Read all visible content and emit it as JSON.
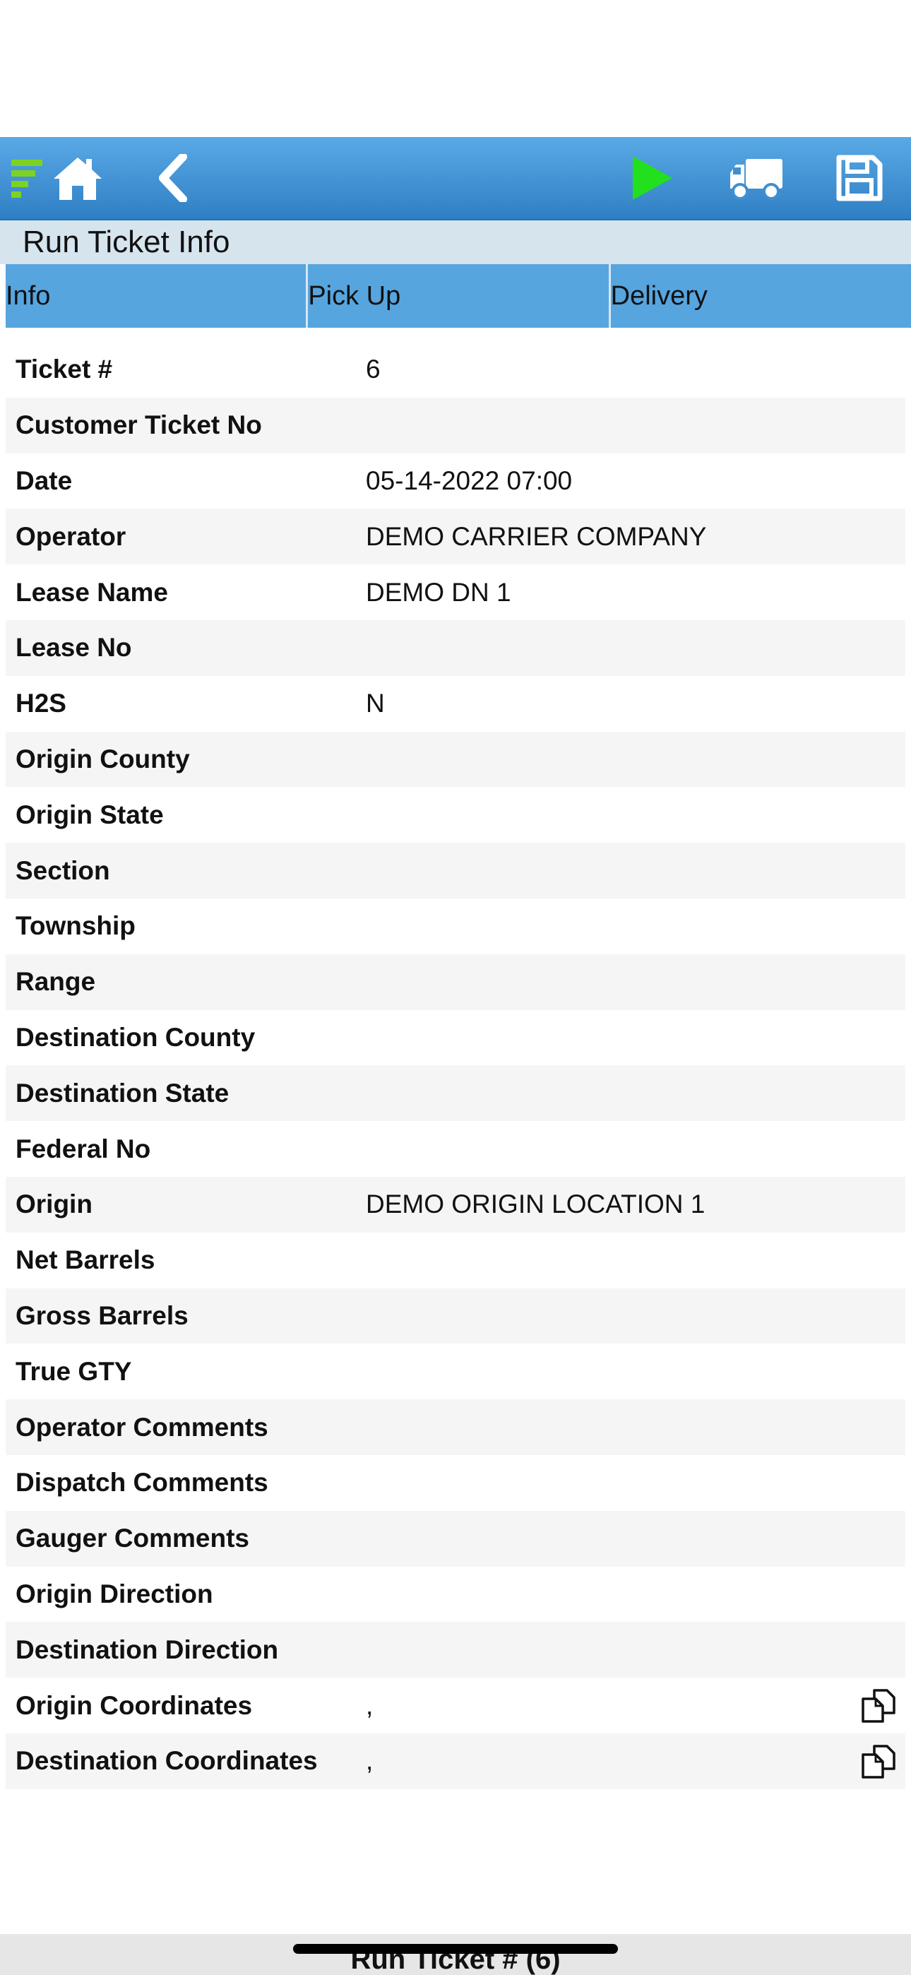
{
  "toolbar": {
    "colors": {
      "background": "#3f8fd2",
      "play": "#22e01e",
      "logo": "#7dd321",
      "icon": "#ffffff"
    },
    "icons": [
      "logo-icon",
      "home-icon",
      "back-icon",
      "play-icon",
      "truck-icon",
      "save-icon"
    ]
  },
  "header": {
    "title": "Run Ticket Info"
  },
  "tabs": [
    {
      "label": "Info"
    },
    {
      "label": "Pick Up"
    },
    {
      "label": "Delivery"
    }
  ],
  "rows": [
    {
      "label": "Ticket #",
      "value": "6"
    },
    {
      "label": "Customer Ticket No",
      "value": ""
    },
    {
      "label": "Date",
      "value": "05-14-2022 07:00"
    },
    {
      "label": "Operator",
      "value": "DEMO CARRIER COMPANY"
    },
    {
      "label": "Lease Name",
      "value": "DEMO DN 1"
    },
    {
      "label": "Lease No",
      "value": ""
    },
    {
      "label": "H2S",
      "value": "N"
    },
    {
      "label": "Origin County",
      "value": ""
    },
    {
      "label": "Origin State",
      "value": ""
    },
    {
      "label": "Section",
      "value": ""
    },
    {
      "label": "Township",
      "value": ""
    },
    {
      "label": "Range",
      "value": ""
    },
    {
      "label": "Destination County",
      "value": ""
    },
    {
      "label": "Destination State",
      "value": ""
    },
    {
      "label": "Federal No",
      "value": ""
    },
    {
      "label": "Origin",
      "value": "DEMO ORIGIN LOCATION 1"
    },
    {
      "label": "Net Barrels",
      "value": ""
    },
    {
      "label": "Gross Barrels",
      "value": ""
    },
    {
      "label": "True GTY",
      "value": ""
    },
    {
      "label": "Operator Comments",
      "value": ""
    },
    {
      "label": "Dispatch Comments",
      "value": ""
    },
    {
      "label": "Gauger Comments",
      "value": ""
    },
    {
      "label": "Origin Direction",
      "value": ""
    },
    {
      "label": "Destination Direction",
      "value": ""
    },
    {
      "label": "Origin Coordinates",
      "value": ",",
      "copy_icon": "copy-icon"
    },
    {
      "label": "Destination Coordinates",
      "value": ",",
      "copy_icon": "copy-icon"
    }
  ],
  "footer": {
    "title": "Run Ticket # (6)"
  }
}
